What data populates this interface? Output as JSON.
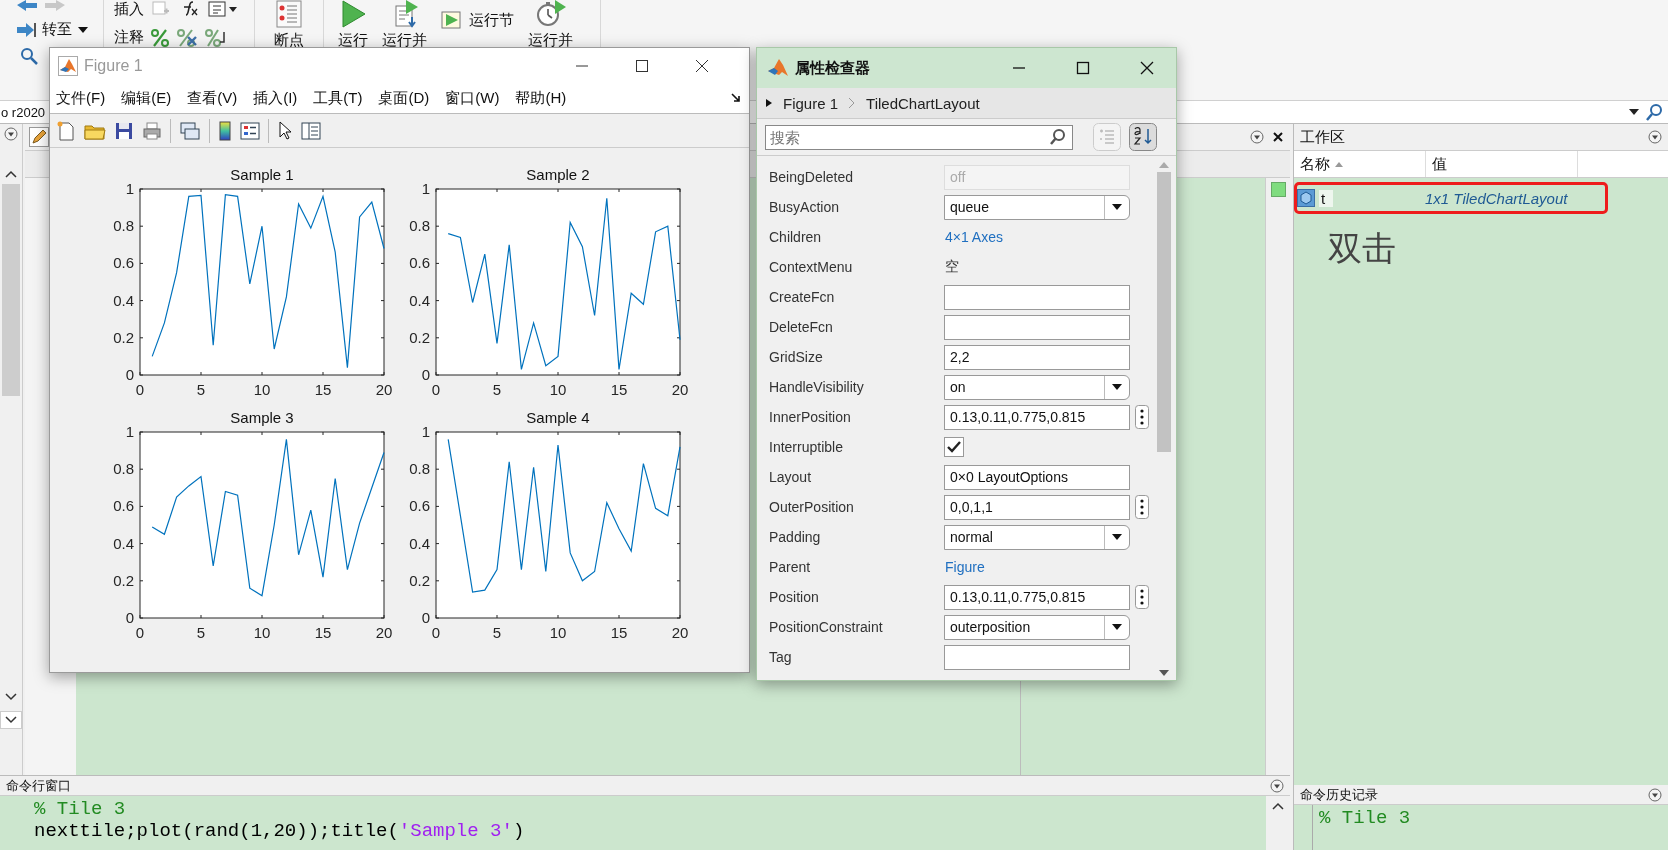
{
  "toolstrip": {
    "goto": "转至",
    "insert": "插入",
    "comment": "注释",
    "breakpoint": "断点",
    "run": "运行",
    "run_advance": "运行并",
    "run_section": "运行节",
    "run_time": "运行并"
  },
  "address_bar": {
    "path": "o r2020"
  },
  "figure_window": {
    "title": "Figure 1",
    "menu": [
      "文件(F)",
      "编辑(E)",
      "查看(V)",
      "插入(I)",
      "工具(T)",
      "桌面(D)",
      "窗口(W)",
      "帮助(H)"
    ],
    "charts": [
      {
        "chart_data": {
          "type": "line",
          "title": "Sample 1",
          "x": [
            1,
            2,
            3,
            4,
            5,
            6,
            7,
            8,
            9,
            10,
            11,
            12,
            13,
            14,
            15,
            16,
            17,
            18,
            19,
            20
          ],
          "xlim": [
            0,
            20
          ],
          "ylim": [
            0,
            1
          ],
          "xticks": [
            0,
            5,
            10,
            15,
            20
          ],
          "yticks": [
            0,
            0.2,
            0.4,
            0.6,
            0.8,
            1
          ],
          "series": [
            {
              "color": "#0072bd",
              "values": [
                0.1,
                0.28,
                0.55,
                0.96,
                0.965,
                0.16,
                0.97,
                0.96,
                0.49,
                0.8,
                0.14,
                0.42,
                0.92,
                0.79,
                0.96,
                0.66,
                0.04,
                0.85,
                0.93,
                0.68
              ]
            }
          ]
        }
      },
      {
        "chart_data": {
          "type": "line",
          "title": "Sample 2",
          "x": [
            1,
            2,
            3,
            4,
            5,
            6,
            7,
            8,
            9,
            10,
            11,
            12,
            13,
            14,
            15,
            16,
            17,
            18,
            19,
            20
          ],
          "xlim": [
            0,
            20
          ],
          "ylim": [
            0,
            1
          ],
          "xticks": [
            0,
            5,
            10,
            15,
            20
          ],
          "yticks": [
            0,
            0.2,
            0.4,
            0.6,
            0.8,
            1
          ],
          "series": [
            {
              "color": "#0072bd",
              "values": [
                0.76,
                0.74,
                0.39,
                0.65,
                0.17,
                0.7,
                0.03,
                0.28,
                0.05,
                0.1,
                0.82,
                0.69,
                0.32,
                0.95,
                0.03,
                0.44,
                0.38,
                0.77,
                0.8,
                0.19
              ]
            }
          ]
        }
      },
      {
        "chart_data": {
          "type": "line",
          "title": "Sample 3",
          "x": [
            1,
            2,
            3,
            4,
            5,
            6,
            7,
            8,
            9,
            10,
            11,
            12,
            13,
            14,
            15,
            16,
            17,
            18,
            19,
            20
          ],
          "xlim": [
            0,
            20
          ],
          "ylim": [
            0,
            1
          ],
          "xticks": [
            0,
            5,
            10,
            15,
            20
          ],
          "yticks": [
            0,
            0.2,
            0.4,
            0.6,
            0.8,
            1
          ],
          "series": [
            {
              "color": "#0072bd",
              "values": [
                0.49,
                0.45,
                0.65,
                0.71,
                0.76,
                0.28,
                0.68,
                0.66,
                0.16,
                0.12,
                0.5,
                0.96,
                0.34,
                0.58,
                0.22,
                0.75,
                0.26,
                0.51,
                0.7,
                0.89
              ]
            }
          ]
        }
      },
      {
        "chart_data": {
          "type": "line",
          "title": "Sample 4",
          "x": [
            1,
            2,
            3,
            4,
            5,
            6,
            7,
            8,
            9,
            10,
            11,
            12,
            13,
            14,
            15,
            16,
            17,
            18,
            19,
            20
          ],
          "xlim": [
            0,
            20
          ],
          "ylim": [
            0,
            1
          ],
          "xticks": [
            0,
            5,
            10,
            15,
            20
          ],
          "yticks": [
            0,
            0.2,
            0.4,
            0.6,
            0.8,
            1
          ],
          "series": [
            {
              "color": "#0072bd",
              "values": [
                0.96,
                0.55,
                0.14,
                0.15,
                0.26,
                0.84,
                0.26,
                0.81,
                0.25,
                0.93,
                0.35,
                0.2,
                0.25,
                0.62,
                0.48,
                0.36,
                0.83,
                0.59,
                0.55,
                0.92
              ]
            }
          ]
        }
      }
    ]
  },
  "property_inspector": {
    "title": "属性检查器",
    "breadcrumb": [
      "Figure 1",
      "TiledChartLayout"
    ],
    "search": {
      "placeholder": "搜索"
    },
    "properties": [
      {
        "name": "BeingDeleted",
        "kind": "readonly",
        "value": "off"
      },
      {
        "name": "BusyAction",
        "kind": "dropdown",
        "value": "queue"
      },
      {
        "name": "Children",
        "kind": "link",
        "value": "4×1 Axes"
      },
      {
        "name": "ContextMenu",
        "kind": "text",
        "value": "空"
      },
      {
        "name": "CreateFcn",
        "kind": "field"
      },
      {
        "name": "DeleteFcn",
        "kind": "field"
      },
      {
        "name": "GridSize",
        "kind": "field",
        "value": "2,2"
      },
      {
        "name": "HandleVisibility",
        "kind": "dropdown",
        "value": "on"
      },
      {
        "name": "InnerPosition",
        "kind": "vector",
        "value": "0.13,0.11,0.775,0.815"
      },
      {
        "name": "Interruptible",
        "kind": "checkbox",
        "checked": true
      },
      {
        "name": "Layout",
        "kind": "field",
        "value": "0×0 LayoutOptions"
      },
      {
        "name": "OuterPosition",
        "kind": "vector",
        "value": "0,0,1,1"
      },
      {
        "name": "Padding",
        "kind": "dropdown",
        "value": "normal"
      },
      {
        "name": "Parent",
        "kind": "link",
        "value": "Figure"
      },
      {
        "name": "Position",
        "kind": "vector",
        "value": "0.13,0.11,0.775,0.815"
      },
      {
        "name": "PositionConstraint",
        "kind": "dropdown",
        "value": "outerposition"
      },
      {
        "name": "Tag",
        "kind": "field"
      }
    ]
  },
  "workspace": {
    "title": "工作区",
    "columns": [
      "名称",
      "值"
    ],
    "rows": [
      {
        "name": "t",
        "value": "1x1 TiledChartLayout",
        "highlighted": true
      }
    ],
    "annotation": "双击"
  },
  "command_window": {
    "title": "命令行窗口",
    "lines": [
      [
        {
          "kind": "comment",
          "text": "% Tile 3"
        }
      ],
      [
        {
          "kind": "code",
          "text": "nexttile;plot(rand(1,20));title("
        },
        {
          "kind": "string",
          "text": "'Sample 3'"
        },
        {
          "kind": "code",
          "text": ")"
        }
      ]
    ]
  },
  "command_history": {
    "title": "命令历史记录",
    "lines": [
      [
        {
          "kind": "comment",
          "text": "% Tile 3"
        }
      ]
    ]
  }
}
